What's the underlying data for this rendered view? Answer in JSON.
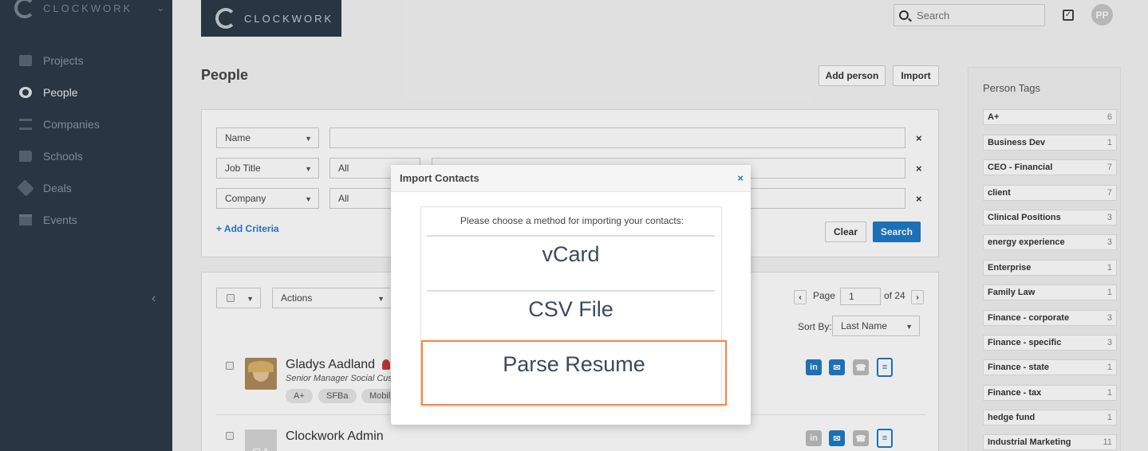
{
  "sidebar": {
    "brand": "CLOCKWORK",
    "items": [
      {
        "label": "Projects",
        "icon": "briefcase-icon"
      },
      {
        "label": "People",
        "icon": "user-circle-icon"
      },
      {
        "label": "Companies",
        "icon": "org-chart-icon"
      },
      {
        "label": "Schools",
        "icon": "book-icon"
      },
      {
        "label": "Deals",
        "icon": "tag-icon"
      },
      {
        "label": "Events",
        "icon": "calendar-icon"
      }
    ],
    "collapse_glyph": "‹"
  },
  "topbar": {
    "brand": "CLOCKWORK",
    "search_placeholder": "Search",
    "task_glyph": "✓",
    "avatar_initials": "PP"
  },
  "page": {
    "title": "People",
    "add_person": "Add person",
    "import": "Import"
  },
  "filters": {
    "rows": [
      {
        "field": "Name",
        "op": "",
        "value": ""
      },
      {
        "field": "Job Title",
        "op": "All",
        "value": ""
      },
      {
        "field": "Company",
        "op": "All",
        "value": ""
      }
    ],
    "add_criteria": "+ Add Criteria",
    "clear": "Clear",
    "search": "Search",
    "remove_glyph": "×"
  },
  "results": {
    "actions": "Actions",
    "page_label": "Page",
    "page_value": "1",
    "of_pages": "of 24",
    "sort_by": "Sort By:",
    "sort_value": "Last Name",
    "people": [
      {
        "name": "Gladys Aadland",
        "subtitle": "Senior Manager Social Cus",
        "tags": [
          "A+",
          "SFBa",
          "Mobil"
        ]
      },
      {
        "name": "Clockwork Admin",
        "subtitle": "",
        "initials": "CA",
        "tags": []
      }
    ]
  },
  "person_tags": {
    "title": "Person Tags",
    "tags": [
      {
        "label": "A+",
        "count": "6"
      },
      {
        "label": "Business Dev",
        "count": "1"
      },
      {
        "label": "CEO - Financial",
        "count": "7"
      },
      {
        "label": "client",
        "count": "7"
      },
      {
        "label": "Clinical Positions",
        "count": "3"
      },
      {
        "label": "energy experience",
        "count": "3"
      },
      {
        "label": "Enterprise",
        "count": "1"
      },
      {
        "label": "Family Law",
        "count": "1"
      },
      {
        "label": "Finance - corporate",
        "count": "3"
      },
      {
        "label": "Finance - specific",
        "count": "3"
      },
      {
        "label": "Finance - state",
        "count": "1"
      },
      {
        "label": "Finance - tax",
        "count": "1"
      },
      {
        "label": "hedge fund",
        "count": "1"
      },
      {
        "label": "Industrial Marketing",
        "count": "11"
      }
    ]
  },
  "modal": {
    "title": "Import Contacts",
    "close_glyph": "×",
    "intro": "Please choose a method for importing your contacts:",
    "methods": [
      "vCard",
      "CSV File",
      "Parse Resume"
    ]
  },
  "colors": {
    "sidebar_bg": "#2d3a48",
    "accent_blue": "#1f7ac6",
    "highlight_orange": "#f08a4b"
  }
}
